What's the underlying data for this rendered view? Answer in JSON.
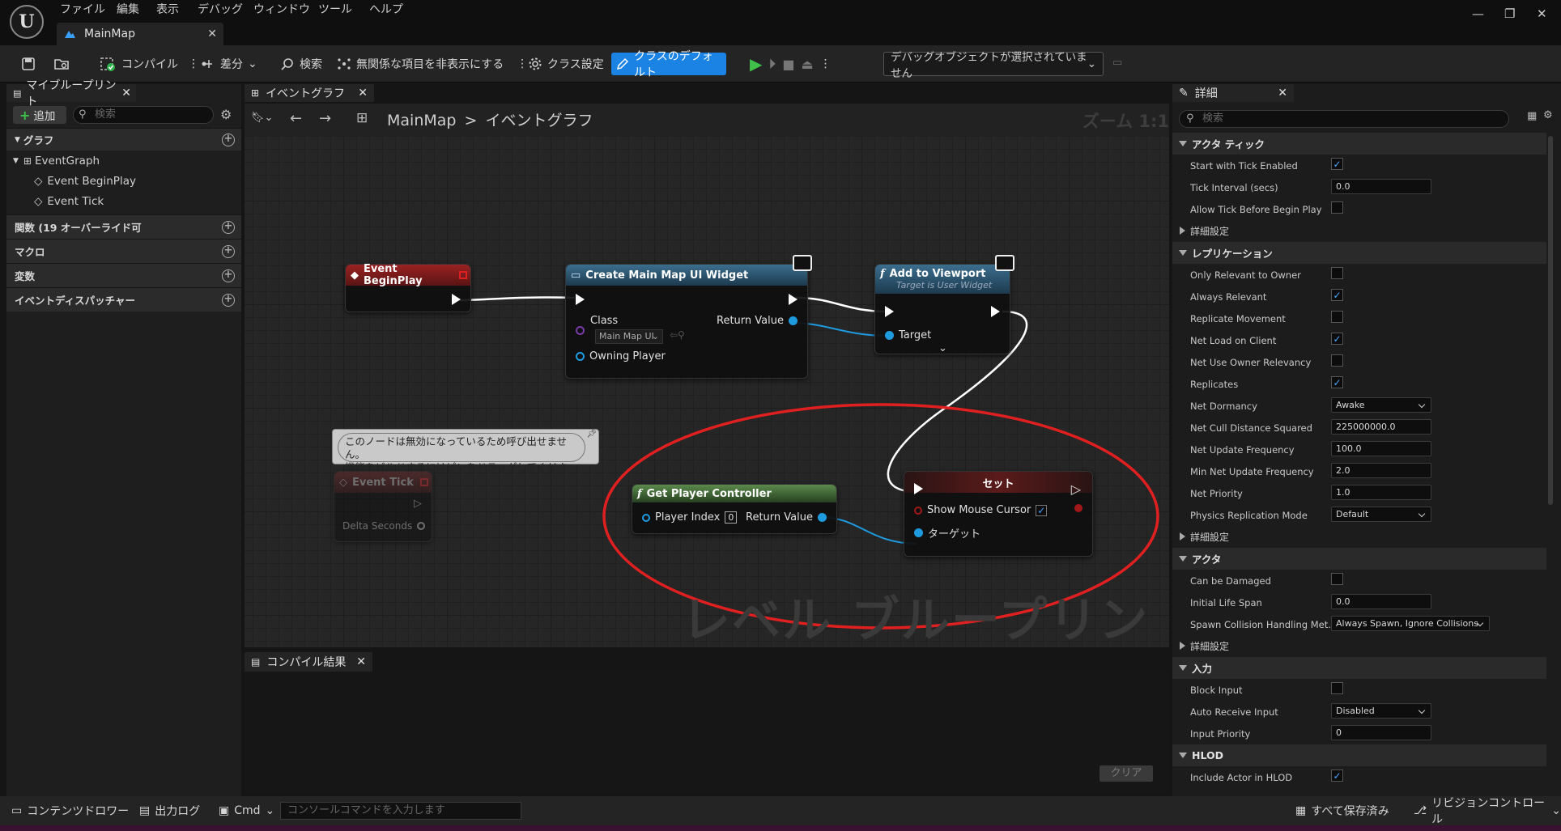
{
  "titlebar": {
    "menus": [
      "ファイル",
      "編集",
      "表示",
      "デバッグ",
      "ウィンドウ",
      "ツール",
      "ヘルプ"
    ],
    "doc_tab": "MainMap",
    "logo_text": "U"
  },
  "toolbar": {
    "compile": "コンパイル",
    "diff": "差分",
    "search": "検索",
    "hide_unrelated": "無関係な項目を非表示にする",
    "class_settings": "クラス設定",
    "class_defaults": "クラスのデフォルト",
    "debug_object": "デバッグオブジェクトが選択されていません"
  },
  "left_panel": {
    "tab": "マイブループリント",
    "add": "追加",
    "search_placeholder": "検索",
    "sections": {
      "graph": "グラフ",
      "functions": "関数 (19 オーバーライド可",
      "macros": "マクロ",
      "variables": "変数",
      "dispatchers": "イベントディスパッチャー"
    },
    "tree": [
      "EventGraph",
      "Event BeginPlay",
      "Event Tick"
    ]
  },
  "graph": {
    "tab": "イベントグラフ",
    "breadcrumb_root": "MainMap",
    "breadcrumb_sep": ">",
    "breadcrumb_leaf": "イベントグラフ",
    "zoom": "ズーム 1:1",
    "watermark": "レベル ブループリント",
    "nodes": {
      "begin_play": {
        "title": "Event BeginPlay"
      },
      "create_widget": {
        "title": "Create Main Map UI Widget",
        "class_label": "Class",
        "class_value": "Main Map UI",
        "return": "Return Value",
        "owning": "Owning Player"
      },
      "add_viewport": {
        "title": "Add to Viewport",
        "subtitle": "Target is User Widget",
        "target": "Target"
      },
      "comment": {
        "line1": "このノードは無効になっているため呼び出せません。",
        "line2": "機能をビルドするにはピンをドラッグしてください。"
      },
      "event_tick": {
        "title": "Event Tick",
        "delta": "Delta Seconds"
      },
      "get_pc": {
        "title": "Get Player Controller",
        "index_label": "Player Index",
        "index_value": "0",
        "return": "Return Value"
      },
      "set": {
        "title": "セット",
        "cursor": "Show Mouse Cursor",
        "target": "ターゲット"
      }
    }
  },
  "compile_results": {
    "tab": "コンパイル結果",
    "clear": "クリア"
  },
  "details": {
    "tab": "詳細",
    "search_placeholder": "検索",
    "sections": {
      "actor_tick": "アクタ ティック",
      "advanced": "詳細設定",
      "replication": "レプリケーション",
      "actor": "アクタ",
      "input": "入力",
      "hlod": "HLOD"
    },
    "rows": {
      "start_tick": {
        "label": "Start with Tick Enabled",
        "checked": true
      },
      "tick_interval": {
        "label": "Tick Interval (secs)",
        "value": "0.0"
      },
      "allow_tick": {
        "label": "Allow Tick Before Begin Play",
        "checked": false
      },
      "only_relevant": {
        "label": "Only Relevant to Owner",
        "checked": false
      },
      "always_relevant": {
        "label": "Always Relevant",
        "checked": true
      },
      "replicate_movement": {
        "label": "Replicate Movement",
        "checked": false
      },
      "net_load": {
        "label": "Net Load on Client",
        "checked": true
      },
      "net_use_owner": {
        "label": "Net Use Owner Relevancy",
        "checked": false
      },
      "replicates": {
        "label": "Replicates",
        "checked": true
      },
      "net_dormancy": {
        "label": "Net Dormancy",
        "value": "Awake"
      },
      "net_cull": {
        "label": "Net Cull Distance Squared",
        "value": "225000000.0"
      },
      "net_update": {
        "label": "Net Update Frequency",
        "value": "100.0"
      },
      "min_net_update": {
        "label": "Min Net Update Frequency",
        "value": "2.0"
      },
      "net_priority": {
        "label": "Net Priority",
        "value": "1.0"
      },
      "physics_rep": {
        "label": "Physics Replication Mode",
        "value": "Default"
      },
      "can_damaged": {
        "label": "Can be Damaged",
        "checked": false
      },
      "life_span": {
        "label": "Initial Life Span",
        "value": "0.0"
      },
      "spawn_collision": {
        "label": "Spawn Collision Handling Met...",
        "value": "Always Spawn, Ignore Collisions"
      },
      "block_input": {
        "label": "Block Input",
        "checked": false
      },
      "auto_receive": {
        "label": "Auto Receive Input",
        "value": "Disabled"
      },
      "input_priority": {
        "label": "Input Priority",
        "value": "0"
      },
      "include_hlod": {
        "label": "Include Actor in HLOD",
        "checked": true
      }
    }
  },
  "status": {
    "content_drawer": "コンテンツドロワー",
    "output_log": "出力ログ",
    "cmd": "Cmd",
    "console_placeholder": "コンソールコマンドを入力します",
    "save_all": "すべて保存済み",
    "revision": "リビジョンコントロール"
  },
  "colors": {
    "accent": "#1a83e3",
    "event_node": "#8a1a1a",
    "function_node": "#27536e",
    "pure_node": "#3d6b35",
    "annotation": "#e02020"
  }
}
